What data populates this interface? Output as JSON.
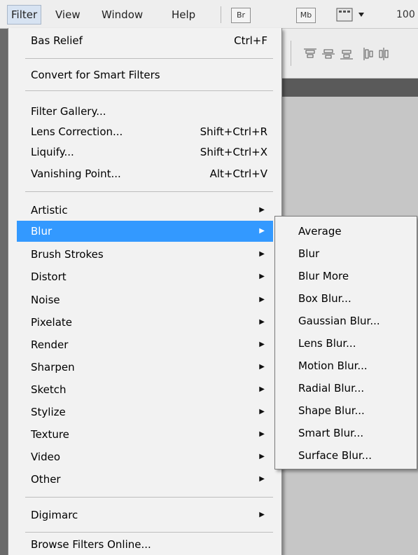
{
  "menubar": {
    "items": [
      {
        "label": "Filter",
        "open": true
      },
      {
        "label": "View"
      },
      {
        "label": "Window"
      },
      {
        "label": "Help"
      }
    ],
    "toolbar": {
      "bridge_label": "Br",
      "minibridge_label": "Mb",
      "zoom_partial": "100"
    }
  },
  "filter_menu": {
    "last_filter": {
      "label": "Bas Relief",
      "shortcut": "Ctrl+F"
    },
    "convert": {
      "label": "Convert for Smart Filters"
    },
    "tools": [
      {
        "label": "Filter Gallery...",
        "shortcut": ""
      },
      {
        "label": "Lens Correction...",
        "shortcut": "Shift+Ctrl+R"
      },
      {
        "label": "Liquify...",
        "shortcut": "Shift+Ctrl+X"
      },
      {
        "label": "Vanishing Point...",
        "shortcut": "Alt+Ctrl+V"
      }
    ],
    "categories": [
      {
        "label": "Artistic"
      },
      {
        "label": "Blur",
        "highlighted": true
      },
      {
        "label": "Brush Strokes"
      },
      {
        "label": "Distort"
      },
      {
        "label": "Noise"
      },
      {
        "label": "Pixelate"
      },
      {
        "label": "Render"
      },
      {
        "label": "Sharpen"
      },
      {
        "label": "Sketch"
      },
      {
        "label": "Stylize"
      },
      {
        "label": "Texture"
      },
      {
        "label": "Video"
      },
      {
        "label": "Other"
      }
    ],
    "digimarc": {
      "label": "Digimarc"
    },
    "browse": {
      "label": "Browse Filters Online..."
    }
  },
  "blur_submenu": {
    "items": [
      "Average",
      "Blur",
      "Blur More",
      "Box Blur...",
      "Gaussian Blur...",
      "Lens Blur...",
      "Motion Blur...",
      "Radial Blur...",
      "Shape Blur...",
      "Smart Blur...",
      "Surface Blur..."
    ]
  },
  "colors": {
    "highlight": "#3399ff",
    "menu_bg": "#f2f2f2"
  }
}
